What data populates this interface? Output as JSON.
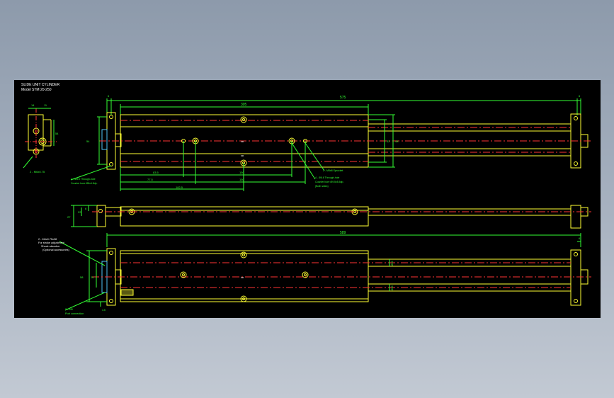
{
  "title_block": {
    "title": "SLIDE UNIT CYLINDER",
    "model": "Model  STM 20-250"
  },
  "colors": {
    "background": "#000000",
    "outline": "#ffff33",
    "dimension": "#33ff33",
    "centerline": "#ff3333",
    "text": "#ffffff"
  },
  "top_view": {
    "overall_length": "575",
    "body_length": "305",
    "end_plate_left": "6",
    "end_plate_right": "6",
    "height": "54",
    "rail_height": "32",
    "rail_outer": "48",
    "pitch_1": "83.5",
    "pitch_1b": "150",
    "pitch_2": "77.5",
    "pitch_2b": "150",
    "pitch_3": "182.5",
    "rail_mark_1": "M6",
    "rail_mark_2": "M6",
    "note_left_1": "4 - M4.5 Through-hole",
    "note_left_2": "Counter bore Ø8x4.5dp.",
    "note_right_1": "2 - M5x8 Sprocket",
    "note_right_2": "4 - Ø6.6 Through-hole",
    "note_right_3": "Counter bore Ø9.5x5.5dp.",
    "note_right_4": "(Both sides)"
  },
  "end_view": {
    "width_1": "14",
    "width_2": "11",
    "height": "54",
    "note": "2 - M6x0.75"
  },
  "side_view": {
    "dim_a": "27",
    "dim_b": "22",
    "dim_c": "6"
  },
  "bottom_view": {
    "overall_length": "589",
    "end_plate": "6",
    "height_1": "58",
    "height_2": "26",
    "edge": "4.5",
    "rod_1": "Ø10",
    "rod_2": "Ø10",
    "note_1": "2 - M4x0.75x28",
    "note_2": "For stroke adjustment",
    "note_3": "Shock absorber",
    "note_4": "(Optional accessories)",
    "note_5": "2 - M5",
    "note_6": "Port connection",
    "center_mark": "M6"
  }
}
